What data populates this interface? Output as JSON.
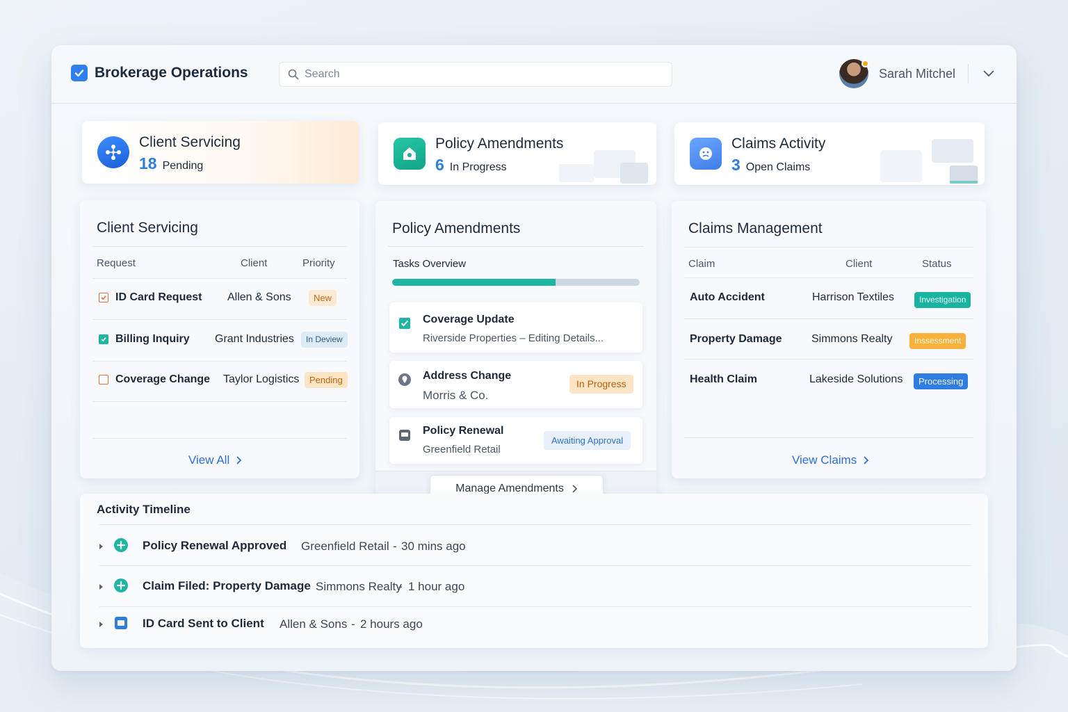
{
  "header": {
    "app_title": "Brokerage Operations",
    "search_placeholder": "Search",
    "user_name": "Sarah Mitchel"
  },
  "kpis": [
    {
      "title": "Client Servicing",
      "count": "18",
      "label": "Pending"
    },
    {
      "title": "Policy Amendments",
      "count": "6",
      "label": "In Progress"
    },
    {
      "title": "Claims Activity",
      "count": "3",
      "label": "Open Claims"
    }
  ],
  "client_servicing": {
    "title": "Client Servicing",
    "columns": [
      "Request",
      "Client",
      "Priority"
    ],
    "rows": [
      {
        "request": "ID Card Request",
        "client": "Allen & Sons",
        "priority": "New",
        "check_color": "#e0703a"
      },
      {
        "request": "Billing Inquiry",
        "client": "Grant Industries",
        "priority": "In Deview",
        "check_color": "#1eb5a3"
      },
      {
        "request": "Coverage Change",
        "client": "Taylor Logistics",
        "priority": "Pending",
        "check_color": "#e0703a"
      }
    ],
    "view_all": "View All"
  },
  "policy_amendments": {
    "title": "Policy Amendments",
    "overview_label": "Tasks Overview",
    "progress": 0.66,
    "tasks": [
      {
        "title": "Coverage Update",
        "subtitle": "Riverside Properties  –  Editing Details...",
        "status": "",
        "icon": "check-square-icon"
      },
      {
        "title": "Address Change",
        "subtitle": "Morris & Co.",
        "status": "In Progress",
        "icon": "location-pin-icon"
      },
      {
        "title": "Policy Renewal",
        "subtitle": "Greenfield Retail",
        "status": "Awaiting Approval",
        "icon": "document-icon"
      }
    ],
    "manage_label": "Manage Amendments"
  },
  "claims": {
    "title": "Claims Management",
    "columns": [
      "Claim",
      "Client",
      "Status"
    ],
    "rows": [
      {
        "claim": "Auto Accident",
        "client": "Harrison Textiles",
        "status": "Investigation"
      },
      {
        "claim": "Property Damage",
        "client": "Simmons Realty",
        "status": "Inssessment"
      },
      {
        "claim": "Health Claim",
        "client": "Lakeside Solutions",
        "status": "Processing"
      }
    ],
    "view_claims": "View Claims"
  },
  "timeline": {
    "title": "Activity Timeline",
    "events": [
      {
        "event": "Policy Renewal Approved",
        "client": "Greenfield Retail",
        "time": "30 mins ago",
        "icon": "plus-circle-icon"
      },
      {
        "event": "Claim Filed: Property Damage",
        "client": "Simmons Realty",
        "time": "1 hour ago",
        "icon": "plus-circle-icon"
      },
      {
        "event": "ID Card Sent to Client",
        "client": "Allen & Sons",
        "time": "2 hours ago",
        "icon": "id-card-icon"
      }
    ]
  },
  "colors": {
    "accent_blue": "#2f7de1",
    "accent_teal": "#1eb5a3",
    "accent_orange": "#f8b13a"
  }
}
